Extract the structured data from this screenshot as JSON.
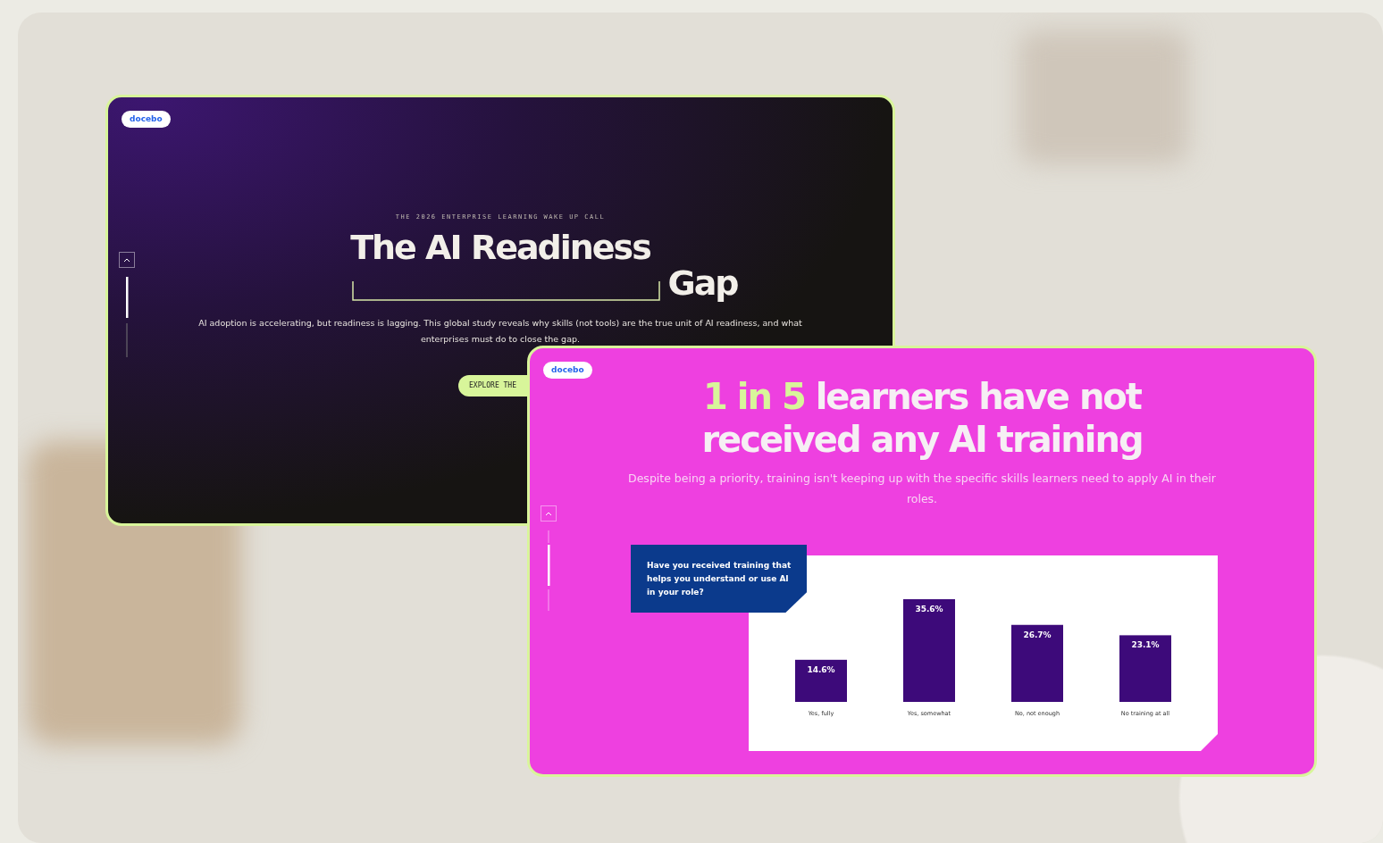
{
  "hero_page": {
    "logo": "docebo",
    "eyebrow": "THE 2026 ENTERPRISE LEARNING WAKE UP CALL",
    "title_line_1": "The AI Readiness",
    "title_line_2": "Gap",
    "description": "AI adoption is accelerating, but readiness is lagging. This global study reveals why skills (not tools) are the true unit of AI readiness, and what enterprises must do to close the gap.",
    "button": "EXPLORE THE"
  },
  "stat_page": {
    "logo": "docebo",
    "headline_highlight": "1 in 5",
    "headline_rest": "learners have not received any AI training",
    "description": "Despite being a priority, training isn't keeping up with the specific skills learners need to apply AI in their roles.",
    "question": "Have you received training that helps you understand or use AI in your role?",
    "chart_data": {
      "type": "bar",
      "categories": [
        "Yes, fully",
        "Yes, somewhat",
        "No, not enough",
        "No training at all"
      ],
      "values": [
        14.6,
        35.6,
        26.7,
        23.1
      ],
      "value_labels": [
        "14.6%",
        "35.6%",
        "26.7%",
        "23.1%"
      ]
    }
  }
}
